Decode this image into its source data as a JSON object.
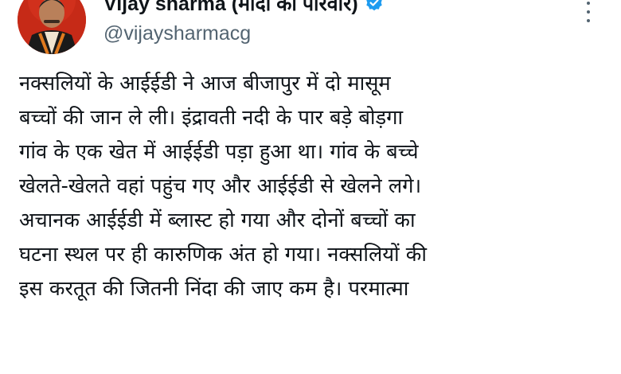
{
  "author": {
    "display_name": "Vijay sharma (मोदी का परिवार)",
    "handle": "@vijaysharmacg",
    "verified": true,
    "verified_icon": "verified-badge-icon",
    "verified_color": "#1d9bf0",
    "avatar_bg_color": "#c62a17"
  },
  "menu": {
    "more_icon": "more-vertical-icon"
  },
  "tweet": {
    "lines": [
      "नक्सलियों के आईईडी ने आज बीजापुर में दो मासूम",
      "बच्चों की जान ले ली। इंद्रावती नदी के पार बड़े बोड़गा",
      "गांव के एक खेत में आईईडी पड़ा हुआ था। गांव के बच्चे",
      "खेलते-खेलते वहां पहुंच गए और आईईडी से खेलने लगे।",
      "अचानक आईईडी में ब्लास्ट हो गया और दोनों बच्चों का",
      "घटना स्थल पर ही कारुणिक अंत हो गया। नक्सलियों की",
      "इस करतूत की जितनी निंदा की जाए कम है। परमात्मा"
    ]
  },
  "colors": {
    "text_primary": "#0f1419",
    "text_secondary": "#536471",
    "background": "#ffffff"
  }
}
